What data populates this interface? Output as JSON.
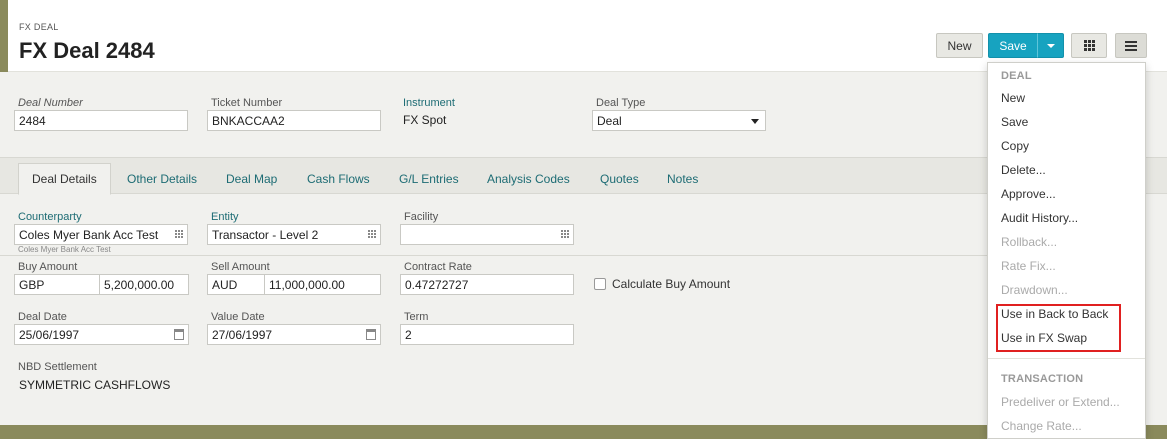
{
  "header": {
    "breadcrumb": "FX DEAL",
    "title": "FX Deal 2484"
  },
  "toolbar": {
    "new_label": "New",
    "save_label": "Save"
  },
  "deal": {
    "deal_number_label": "Deal Number",
    "deal_number": "2484",
    "ticket_number_label": "Ticket Number",
    "ticket_number": "BNKACCAA2",
    "instrument_label": "Instrument",
    "instrument": "FX Spot",
    "deal_type_label": "Deal Type",
    "deal_type": "Deal"
  },
  "tabs": [
    {
      "label": "Deal Details",
      "active": true
    },
    {
      "label": "Other Details"
    },
    {
      "label": "Deal Map"
    },
    {
      "label": "Cash Flows"
    },
    {
      "label": "G/L Entries"
    },
    {
      "label": "Analysis Codes"
    },
    {
      "label": "Quotes"
    },
    {
      "label": "Notes"
    }
  ],
  "details": {
    "counterparty_label": "Counterparty",
    "counterparty": "Coles Myer Bank Acc Test",
    "counterparty_hint": "Coles Myer Bank Acc Test",
    "entity_label": "Entity",
    "entity": "Transactor - Level 2",
    "facility_label": "Facility",
    "facility": "",
    "buy_amount_label": "Buy Amount",
    "buy_currency": "GBP",
    "buy_amount": "5,200,000.00",
    "sell_amount_label": "Sell Amount",
    "sell_currency": "AUD",
    "sell_amount": "11,000,000.00",
    "contract_rate_label": "Contract Rate",
    "contract_rate": "0.47272727",
    "calculate_buy_label": "Calculate Buy Amount",
    "deal_date_label": "Deal Date",
    "deal_date": "25/06/1997",
    "value_date_label": "Value Date",
    "value_date": "27/06/1997",
    "term_label": "Term",
    "term": "2",
    "nbd_label": "NBD Settlement",
    "nbd_value": "SYMMETRIC CASHFLOWS"
  },
  "menu": {
    "deal_header": "DEAL",
    "deal_items": [
      {
        "label": "New",
        "disabled": false
      },
      {
        "label": "Save",
        "disabled": false
      },
      {
        "label": "Copy",
        "disabled": false
      },
      {
        "label": "Delete...",
        "disabled": false
      },
      {
        "label": "Approve...",
        "disabled": false
      },
      {
        "label": "Audit History...",
        "disabled": false
      },
      {
        "label": "Rollback...",
        "disabled": true
      },
      {
        "label": "Rate Fix...",
        "disabled": true
      },
      {
        "label": "Drawdown...",
        "disabled": true
      },
      {
        "label": "Use in Back to Back",
        "disabled": false
      },
      {
        "label": "Use in FX Swap",
        "disabled": false
      }
    ],
    "transaction_header": "TRANSACTION",
    "transaction_items": [
      {
        "label": "Predeliver or Extend...",
        "disabled": true
      },
      {
        "label": "Change Rate...",
        "disabled": true
      }
    ]
  },
  "colors": {
    "accent": "#17a3c0",
    "link_teal": "#1d6c74",
    "highlight_box": "#e02020"
  }
}
